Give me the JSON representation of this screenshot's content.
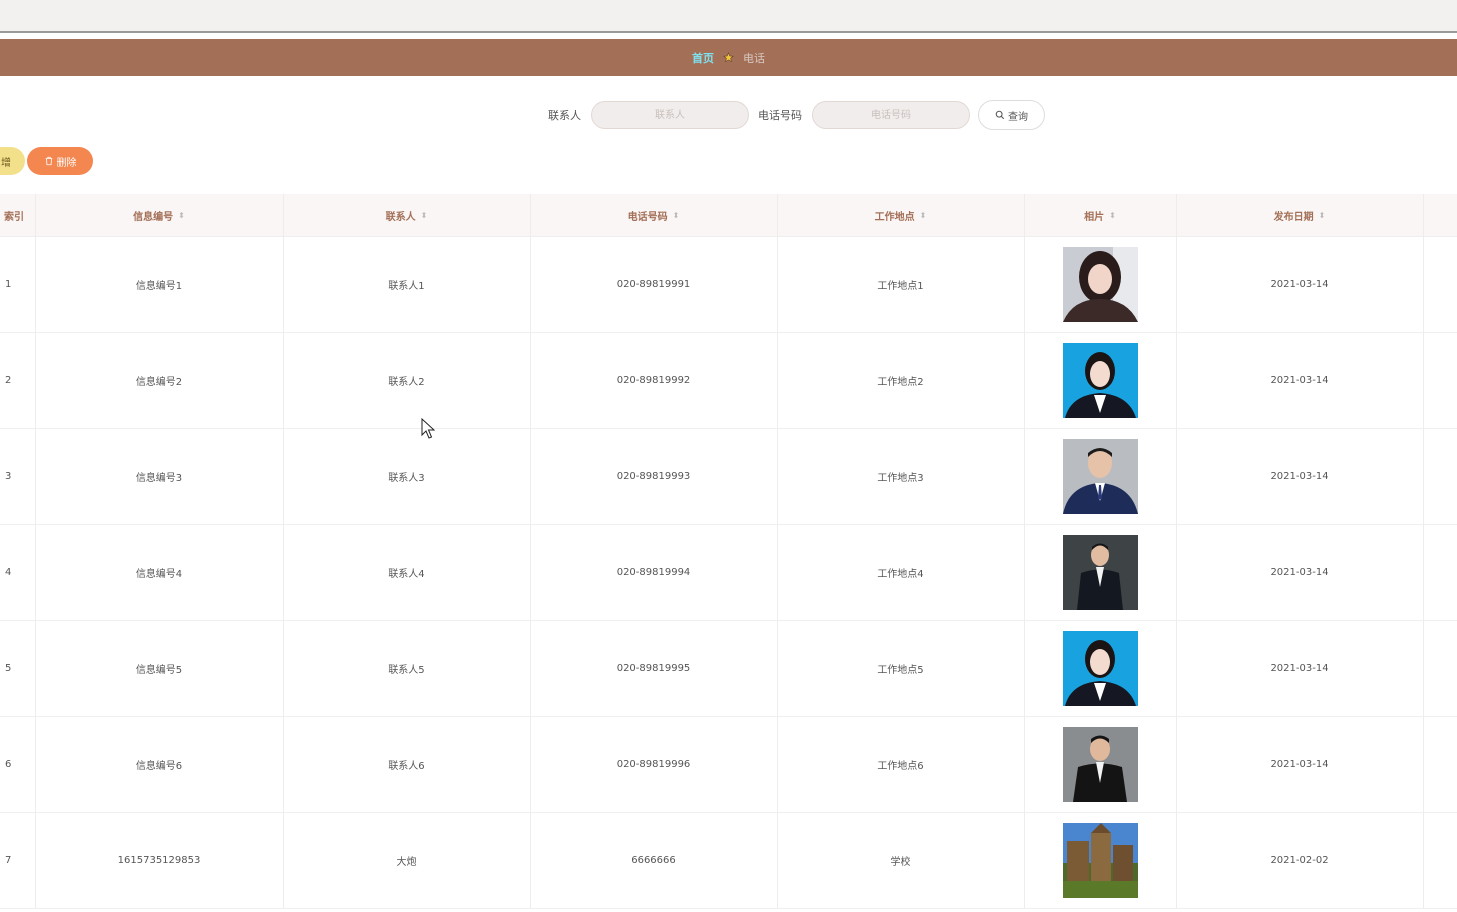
{
  "breadcrumb": {
    "home": "首页",
    "current": "电话"
  },
  "search": {
    "contact_label": "联系人",
    "contact_placeholder": "联系人",
    "phone_label": "电话号码",
    "phone_placeholder": "电话号码",
    "query_label": "查询"
  },
  "actions": {
    "add_label": "增",
    "delete_label": "删除"
  },
  "table": {
    "headers": [
      "索引",
      "信息编号",
      "联系人",
      "电话号码",
      "工作地点",
      "相片",
      "发布日期"
    ],
    "rows": [
      {
        "index": "1",
        "info_no": "信息编号1",
        "contact": "联系人1",
        "phone": "020-89819991",
        "location": "工作地点1",
        "photo": "woman-portrait-casual",
        "date": "2021-03-14"
      },
      {
        "index": "2",
        "info_no": "信息编号2",
        "contact": "联系人2",
        "phone": "020-89819992",
        "location": "工作地点2",
        "photo": "woman-portrait-blue",
        "date": "2021-03-14"
      },
      {
        "index": "3",
        "info_no": "信息编号3",
        "contact": "联系人3",
        "phone": "020-89819993",
        "location": "工作地点3",
        "photo": "man-portrait-grey",
        "date": "2021-03-14"
      },
      {
        "index": "4",
        "info_no": "信息编号4",
        "contact": "联系人4",
        "phone": "020-89819994",
        "location": "工作地点4",
        "photo": "man-portrait-dark",
        "date": "2021-03-14"
      },
      {
        "index": "5",
        "info_no": "信息编号5",
        "contact": "联系人5",
        "phone": "020-89819995",
        "location": "工作地点5",
        "photo": "woman-portrait-blue",
        "date": "2021-03-14"
      },
      {
        "index": "6",
        "info_no": "信息编号6",
        "contact": "联系人6",
        "phone": "020-89819996",
        "location": "工作地点6",
        "photo": "man-portrait-grey",
        "date": "2021-03-14"
      },
      {
        "index": "7",
        "info_no": "1615735129853",
        "contact": "大炮",
        "phone": "6666666",
        "location": "学校",
        "photo": "building-photo",
        "date": "2021-02-02"
      }
    ]
  },
  "colors": {
    "header_bar": "#a36f57",
    "breadcrumb_home": "#7ee1f0",
    "delete_button": "#f4864f",
    "add_button": "#f3e08a"
  }
}
